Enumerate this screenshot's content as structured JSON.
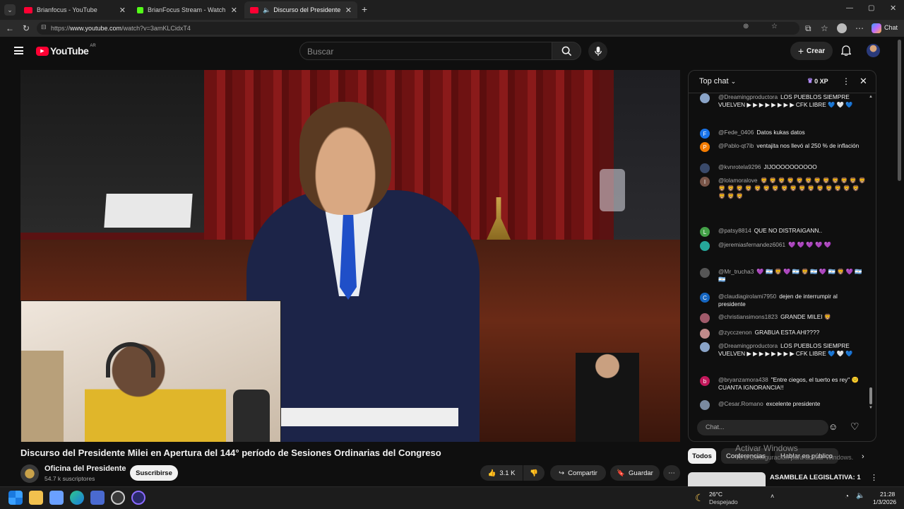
{
  "browser": {
    "tabs": [
      {
        "label": "Brianfocus - YouTube",
        "fav_color": "#ff0033"
      },
      {
        "label": "BrianFocus Stream - Watch Live o",
        "fav_color": "#53fc18"
      },
      {
        "label": "Discurso del Presidente Milei",
        "fav_color": "#ff0033"
      }
    ],
    "url_prefix": "https://",
    "url_host": "www.youtube.com",
    "url_path": "/watch?v=3amKLCidxT4",
    "chat_label": "Chat"
  },
  "masthead": {
    "logo": "YouTube",
    "region": "AR",
    "search_placeholder": "Buscar",
    "create_label": "Crear"
  },
  "video": {
    "title": "Discurso del Presidente Milei en Apertura del 144° período de Sesiones Ordinarias del Congreso"
  },
  "channel": {
    "name": "Oficina del Presidente",
    "subscribers": "54.7 k suscriptores",
    "subscribe_label": "Suscribirse"
  },
  "actions": {
    "likes": "3.1 K",
    "share": "Compartir",
    "save": "Guardar"
  },
  "chat": {
    "header": "Top chat",
    "xp": "0 XP",
    "input_placeholder": "Chat...",
    "messages": [
      {
        "user": "@Dreamingproductora",
        "text": "LOS PUEBLOS SIEMPRE VUELVEN ▶ ▶ ▶ ▶ ▶ ▶ ▶ ▶ CFK LIBRE 💙 🤍 💙",
        "av": "#8aa4c8"
      },
      {
        "user": "@Fede_0406",
        "text": "Datos kukas datos",
        "av": "#1a73e8",
        "letter": "F"
      },
      {
        "user": "@Pablo-qt7ib",
        "text": "ventajita nos llevó al 250 % de inflación",
        "av": "#f57c00",
        "letter": "P"
      },
      {
        "user": "@kvnrotela9296",
        "text": "JIJOOOOOOOOOO",
        "av": "#3a4a6a"
      },
      {
        "user": "@lolamoralove",
        "text": "🦁 🦁 🦁 🦁 🦁 🦁 🦁 🦁 🦁 🦁 🦁 🦁 🦁 🦁 🦁 🦁 🦁 🦁 🦁 🦁 🦁 🦁 🦁 🦁 🦁 🦁 🦁 🦁 🦁 🦁 🦁",
        "av": "#795548",
        "letter": "l"
      },
      {
        "user": "@patsy8814",
        "text": "QUE NO DISTRAIGANN..",
        "av": "#43a047",
        "letter": "L"
      },
      {
        "user": "@jeremiasfernandez6061",
        "text": "💜 💜 💜 💜 💜",
        "av": "#26a69a"
      },
      {
        "user": "@Mr_trucha3",
        "text": "💜 🇦🇷 🦁 💜 🇦🇷 🦁 🇦🇷 💜 🇦🇷 🦁 💜 🇦🇷 🇦🇷",
        "av": "#555"
      },
      {
        "user": "@claudiagirolami7950",
        "text": "dejen de interrumpir al presidente",
        "av": "#1565c0",
        "letter": "C"
      },
      {
        "user": "@christiansimons1823",
        "text": "GRANDE MILEI 🦁",
        "av": "#a05a6a"
      },
      {
        "user": "@zycczenon",
        "text": "GRABUA ESTA AHI????",
        "av": "#c08a8a"
      },
      {
        "user": "@Dreamingproductora",
        "text": "LOS PUEBLOS SIEMPRE VUELVEN ▶ ▶ ▶ ▶ ▶ ▶ ▶ ▶ CFK LIBRE 💙 🤍 💙",
        "av": "#8aa4c8"
      },
      {
        "user": "@bryanzamora438",
        "text": "\"Entre ciegos, el tuerto es rey\" 😕 CUANTA IGNORANCIA!!",
        "av": "#c2185b",
        "letter": "b"
      },
      {
        "user": "@Cesar.Romano",
        "text": "excelente presidente",
        "av": "#7a8aa0"
      }
    ]
  },
  "chips": [
    "Todos",
    "Conferencias",
    "Hablar en público"
  ],
  "recommendation": {
    "title": "ASAMBLEA LEGISLATIVA: 1"
  },
  "watermark": {
    "line1": "Activar Windows",
    "line2": "Ve a Configuración para activar Windows."
  },
  "taskbar": {
    "temp": "26°C",
    "weather": "Despejado",
    "time": "21:28",
    "date": "1/3/2026"
  }
}
